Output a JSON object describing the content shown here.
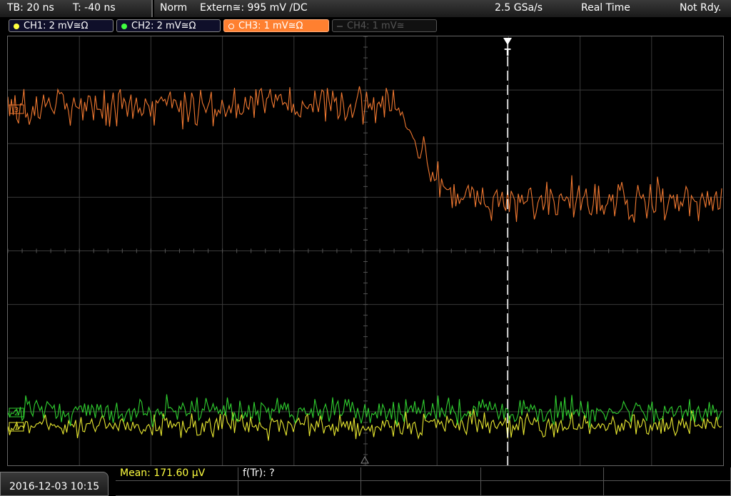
{
  "topbar": {
    "timebase": "TB: 20 ns",
    "trigger_time": "T: -40 ns",
    "mode": "Norm",
    "trigger_source": "Extern≅: 995 mV ∕DC",
    "sample_rate": "2.5 GSa/s",
    "acq_mode": "Real Time",
    "status": "Not Rdy."
  },
  "channels": [
    {
      "label": "CH1: 2 mV≅Ω",
      "color": "#ffff40",
      "active": true
    },
    {
      "label": "CH2: 2 mV≅Ω",
      "color": "#40ff40",
      "active": true
    },
    {
      "label": "CH3: 1 mV≅Ω",
      "color": "#ff8030",
      "active": true
    },
    {
      "label": "CH4: 1 mV≅",
      "color": "#555555",
      "active": false
    }
  ],
  "screen": {
    "trigger_marker": "T",
    "ch3_marker": "3",
    "ch2_marker": "2",
    "ch1_marker": "1",
    "trace_colors": {
      "ch1": "#e8e830",
      "ch2": "#30d030",
      "ch3": "#f07830"
    }
  },
  "bottombar": {
    "datetime": "2016-12-03 10:15",
    "mean_label": "Mean: 171.60 µV",
    "rise_label": "f(Tr): ?"
  }
}
